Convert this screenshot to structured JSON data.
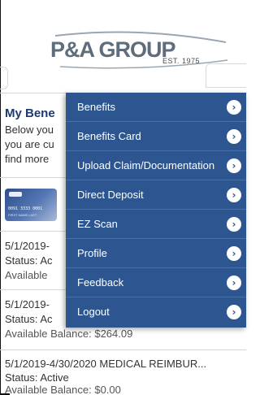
{
  "header": {
    "logo_text": "P&A GROUP",
    "est_text": "EST. 1975"
  },
  "benefits_intro": {
    "title": "My Bene",
    "line1": "Below you",
    "line2": "you are cu",
    "line3": "find more"
  },
  "accounts": [
    {
      "period": "5/1/2019-",
      "status": "Status: Ac",
      "balance": "Available"
    },
    {
      "period": "5/1/2019-",
      "status": "Status: Ac",
      "balance": "Available Balance: $264.09"
    },
    {
      "period": "5/1/2019-4/30/2020 MEDICAL REIMBUR...",
      "status": "Status: Active",
      "balance": "Available Balance: $0.00"
    }
  ],
  "menu": {
    "items": [
      {
        "label": "Benefits"
      },
      {
        "label": "Benefits Card"
      },
      {
        "label": "Upload Claim/Documentation"
      },
      {
        "label": "Direct Deposit"
      },
      {
        "label": "EZ Scan"
      },
      {
        "label": "Profile"
      },
      {
        "label": "Feedback"
      },
      {
        "label": "Logout"
      }
    ],
    "chevron": "›"
  },
  "colors": {
    "menu_bg": "#2d5690",
    "title_blue": "#1d3a6e",
    "logo_gray": "#5d6d7c"
  }
}
